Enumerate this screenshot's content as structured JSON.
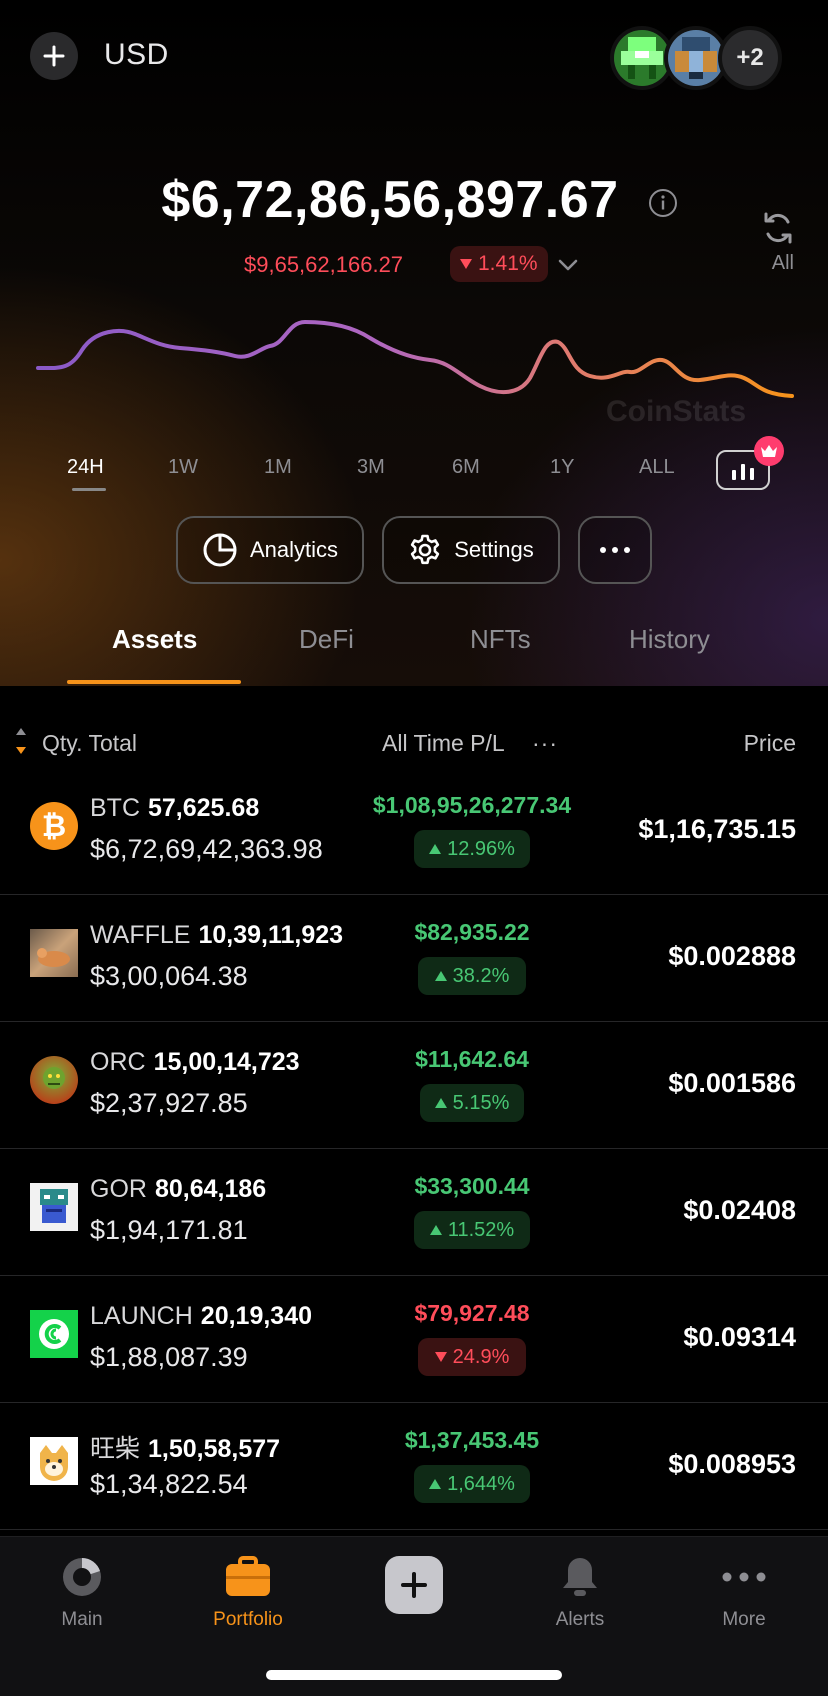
{
  "header": {
    "add_icon": "plus-icon",
    "currency": "USD",
    "more_avatars": "+2"
  },
  "portfolio": {
    "total_value": "$6,72,86,56,897.67",
    "change_amount": "$9,65,62,166.27",
    "change_percent": "1.41%",
    "change_direction": "down",
    "refresh_label": "All",
    "watermark": "CoinStats"
  },
  "chart_colors": {
    "start": "#8a5ac8",
    "end": "#f7931a"
  },
  "time_ranges": [
    "24H",
    "1W",
    "1M",
    "3M",
    "6M",
    "1Y",
    "ALL"
  ],
  "active_range": "24H",
  "actions": {
    "analytics_label": "Analytics",
    "settings_label": "Settings"
  },
  "tabs": [
    "Assets",
    "DeFi",
    "NFTs",
    "History"
  ],
  "active_tab": "Assets",
  "table": {
    "col_qty_total": "Qty. Total",
    "col_pl": "All Time P/L",
    "col_pl_more": "···",
    "col_price": "Price"
  },
  "assets": [
    {
      "symbol": "BTC",
      "qty": "57,625.68",
      "total": "$6,72,69,42,363.98",
      "pl": "$1,08,95,26,277.34",
      "pl_pct": "12.96%",
      "dir": "up",
      "price": "$1,16,735.15"
    },
    {
      "symbol": "WAFFLE",
      "qty": "10,39,11,923",
      "total": "$3,00,064.38",
      "pl": "$82,935.22",
      "pl_pct": "38.2%",
      "dir": "up",
      "price": "$0.002888"
    },
    {
      "symbol": "ORC",
      "qty": "15,00,14,723",
      "total": "$2,37,927.85",
      "pl": "$11,642.64",
      "pl_pct": "5.15%",
      "dir": "up",
      "price": "$0.001586"
    },
    {
      "symbol": "GOR",
      "qty": "80,64,186",
      "total": "$1,94,171.81",
      "pl": "$33,300.44",
      "pl_pct": "11.52%",
      "dir": "up",
      "price": "$0.02408"
    },
    {
      "symbol": "LAUNCH",
      "qty": "20,19,340",
      "total": "$1,88,087.39",
      "pl": "$79,927.48",
      "pl_pct": "24.9%",
      "dir": "down",
      "price": "$0.09314"
    },
    {
      "symbol": "旺柴",
      "qty": "1,50,58,577",
      "total": "$1,34,822.54",
      "pl": "$1,37,453.45",
      "pl_pct": "1,644%",
      "dir": "up",
      "price": "$0.008953"
    }
  ],
  "tabbar": {
    "main": "Main",
    "portfolio": "Portfolio",
    "alerts": "Alerts",
    "more": "More"
  }
}
